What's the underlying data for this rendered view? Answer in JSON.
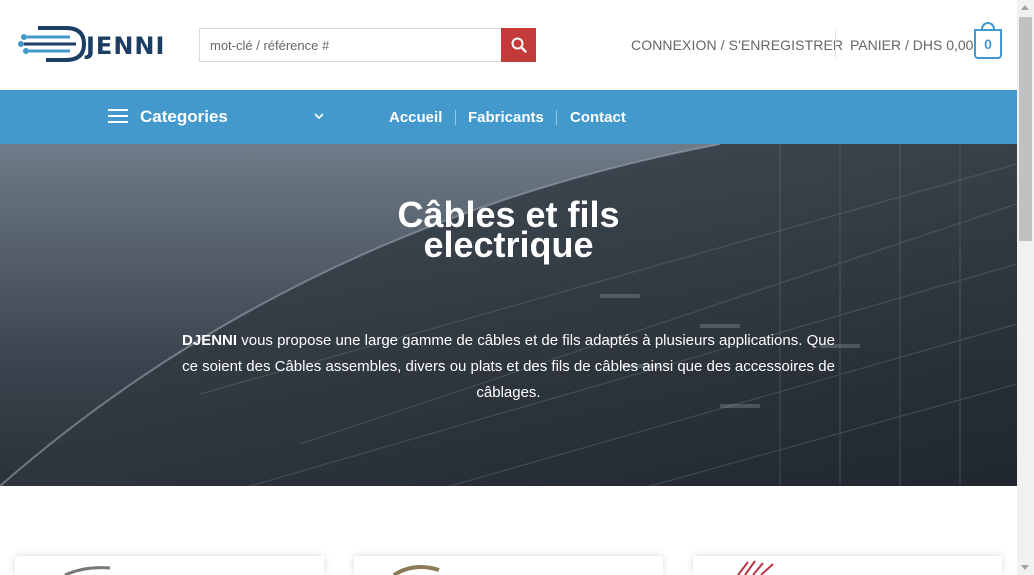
{
  "header": {
    "logo_text": "JENNI",
    "search_placeholder": "mot-clé / référence #",
    "account_label": "CONNEXION / S'ENREGISTRER",
    "cart_label": "PANIER / DHS 0,00",
    "cart_count": "0"
  },
  "nav": {
    "categories_label": "Categories",
    "links": [
      "Accueil",
      "Fabricants",
      "Contact"
    ]
  },
  "hero": {
    "title_line1": "Câbles et fils",
    "title_line2": "electrique",
    "desc_brand": "DJENNI",
    "desc_rest": " vous propose une large gamme de câbles et de fils adaptés à plusieurs applications. Que ce soient des Câbles assembles, divers ou plats et des fils de câbles ainsi que des accessoires de câblages."
  },
  "colors": {
    "brand_blue": "#4499cc",
    "search_red": "#c33a3a",
    "logo_navy": "#1d3e64"
  },
  "icons": [
    "logo-icon",
    "search-icon",
    "menu-icon",
    "chevron-down-icon",
    "cart-icon"
  ]
}
